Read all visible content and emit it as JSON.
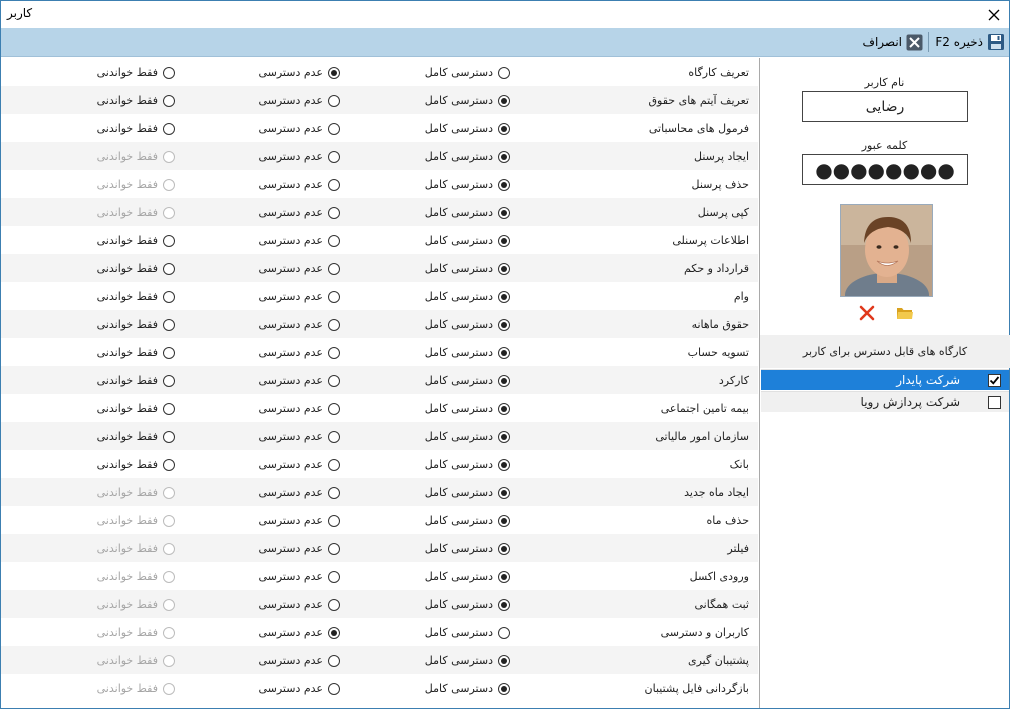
{
  "window": {
    "title": "کاربر"
  },
  "toolbar": {
    "save_label": "ذخیره F2",
    "cancel_label": "انصراف"
  },
  "user": {
    "username_label": "نام کاربر",
    "username_value": "رضایی",
    "password_label": "کلمه عبور",
    "password_mask": "●●●●●●●●"
  },
  "workshops": {
    "header": "کارگاه های قابل دسترس برای کاربر",
    "items": [
      {
        "label": "شرکت پایدار",
        "checked": true,
        "selected": true
      },
      {
        "label": "شرکت پردازش رویا",
        "checked": false,
        "selected": false
      }
    ]
  },
  "option_labels": {
    "full": "دسترسی کامل",
    "none": "عدم دسترسی",
    "read": "فقط خواندنی"
  },
  "permissions": [
    {
      "name": "تعریف کارگاه",
      "value": "none",
      "read_enabled": true
    },
    {
      "name": "تعریف آیتم های حقوق",
      "value": "full",
      "read_enabled": true
    },
    {
      "name": "فرمول های محاسباتی",
      "value": "full",
      "read_enabled": true
    },
    {
      "name": "ایجاد پرسنل",
      "value": "full",
      "read_enabled": false
    },
    {
      "name": "حذف پرسنل",
      "value": "full",
      "read_enabled": false
    },
    {
      "name": "کپی پرسنل",
      "value": "full",
      "read_enabled": false
    },
    {
      "name": "اطلاعات پرسنلی",
      "value": "full",
      "read_enabled": true
    },
    {
      "name": "قرارداد و حکم",
      "value": "full",
      "read_enabled": true
    },
    {
      "name": "وام",
      "value": "full",
      "read_enabled": true
    },
    {
      "name": "حقوق ماهانه",
      "value": "full",
      "read_enabled": true
    },
    {
      "name": "تسویه حساب",
      "value": "full",
      "read_enabled": true
    },
    {
      "name": "کارکرد",
      "value": "full",
      "read_enabled": true
    },
    {
      "name": "بیمه تامین اجتماعی",
      "value": "full",
      "read_enabled": true
    },
    {
      "name": "سازمان امور مالیاتی",
      "value": "full",
      "read_enabled": true
    },
    {
      "name": "بانک",
      "value": "full",
      "read_enabled": true
    },
    {
      "name": "ایجاد ماه جدید",
      "value": "full",
      "read_enabled": false
    },
    {
      "name": "حذف ماه",
      "value": "full",
      "read_enabled": false
    },
    {
      "name": "فیلتر",
      "value": "full",
      "read_enabled": false
    },
    {
      "name": "ورودی اکسل",
      "value": "full",
      "read_enabled": false
    },
    {
      "name": "ثبت همگانی",
      "value": "full",
      "read_enabled": false
    },
    {
      "name": "کاربران و دسترسی",
      "value": "none",
      "read_enabled": false
    },
    {
      "name": "پشتیبان گیری",
      "value": "full",
      "read_enabled": false
    },
    {
      "name": "بازگردانی فایل پشتیبان",
      "value": "full",
      "read_enabled": false
    }
  ],
  "icons": {
    "close": "close-icon",
    "save": "floppy-disk-icon",
    "cancel": "cancel-x-icon",
    "delete_photo": "red-x-icon",
    "open_folder": "folder-icon"
  },
  "colors": {
    "toolbar_bg": "#b7d4e8",
    "selected_row": "#1e80d9",
    "delete_red": "#e0381c",
    "folder_yellow": "#e8b62c"
  }
}
